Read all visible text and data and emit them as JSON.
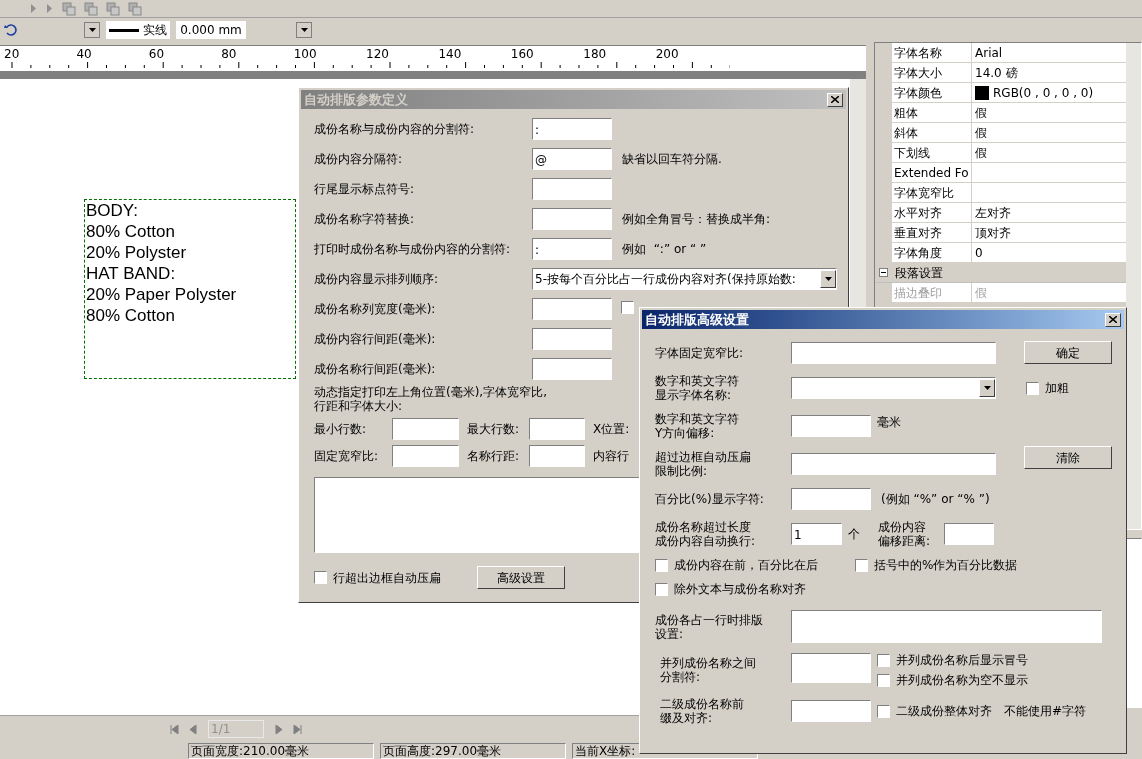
{
  "toolbar": {
    "line_style": "实线",
    "line_width": "0.000 mm"
  },
  "ruler": {
    "labels": [
      "20",
      "40",
      "60",
      "80",
      "100",
      "120",
      "140",
      "160",
      "180",
      "200"
    ]
  },
  "canvas": {
    "text_lines": [
      "BODY:",
      "80% Cotton",
      "20% Polyster",
      "HAT BAND:",
      "20% Paper Polyster",
      "80% Cotton"
    ]
  },
  "properties": {
    "rows": [
      {
        "name": "字体名称",
        "value": "Arial",
        "kind": "text",
        "disabled": false
      },
      {
        "name": "字体大小",
        "value": "14.0 磅",
        "kind": "text",
        "disabled": false
      },
      {
        "name": "字体颜色",
        "value": "RGB(0 , 0 , 0 , 0)",
        "kind": "color",
        "color": "#000000",
        "disabled": false
      },
      {
        "name": "粗体",
        "value": "假",
        "kind": "text",
        "disabled": false
      },
      {
        "name": "斜体",
        "value": "假",
        "kind": "text",
        "disabled": false
      },
      {
        "name": "下划线",
        "value": "假",
        "kind": "text",
        "disabled": false
      },
      {
        "name": "Extended Fo",
        "kind": "text",
        "disabled": false
      },
      {
        "name": "字体宽窄比",
        "kind": "text",
        "disabled": false
      },
      {
        "name": "水平对齐",
        "value": "左对齐",
        "kind": "text",
        "disabled": false
      },
      {
        "name": "垂直对齐",
        "value": "顶对齐",
        "kind": "text",
        "disabled": false
      },
      {
        "name": "字体角度",
        "value": "0",
        "kind": "text",
        "disabled": false
      },
      {
        "name": "段落设置",
        "kind": "section",
        "expanded": true
      },
      {
        "name": "描边叠印",
        "value": "假",
        "kind": "text",
        "disabled": true
      }
    ]
  },
  "page_nav": {
    "page": "1/1"
  },
  "status_bar": [
    "页面宽度:210.00毫米",
    "页面高度:297.00毫米",
    "当前X坐标:"
  ],
  "dialog_main": {
    "title": "自动排版参数定义",
    "active": false,
    "rows": [
      {
        "kind": "input",
        "label": "成份名称与成份内容的分割符:",
        "value": ":"
      },
      {
        "kind": "input",
        "label": "成份内容分隔符:",
        "value": "@",
        "note": "缺省以回车符分隔."
      },
      {
        "kind": "input",
        "label": "行尾显示标点符号:"
      },
      {
        "kind": "input",
        "label": "成份名称字符替换:",
        "note": "例如全角冒号：替换成半角:"
      },
      {
        "kind": "input",
        "label": "打印时成份名称与成份内容的分割符:",
        "value": ":",
        "note": "例如  “:” or “ ”"
      },
      {
        "kind": "select",
        "label": "成份内容显示排列顺序:",
        "value": "5-按每个百分比占一行成份内容对齐(保持原始数:"
      },
      {
        "kind": "input_check",
        "label": "成份名称列宽度(毫米):",
        "checked": false
      },
      {
        "kind": "input",
        "label": "成份内容行间距(毫米):"
      },
      {
        "kind": "input",
        "label": "成份名称行间距(毫米):"
      }
    ],
    "position_note": "动态指定打印左上角位置(毫米),字体宽窄比,\n行距和字体大小:",
    "grid": [
      [
        {
          "label": "最小行数:"
        },
        {
          "label": "最大行数:"
        },
        {
          "label": "X位置:"
        }
      ],
      [
        {
          "label": "固定宽窄比:"
        },
        {
          "label": "名称行距:"
        },
        {
          "label": "内容行"
        }
      ]
    ],
    "compress": {
      "label": "行超出边框自动压扁",
      "checked": false
    },
    "advanced_button": "高级设置"
  },
  "dialog_adv": {
    "title": "自动排版高级设置",
    "active": true,
    "width_ratio": {
      "label": "字体固定宽窄比:"
    },
    "ok_button": "确定",
    "font_name": {
      "label": "数字和英文字符显示字体名称:"
    },
    "bold": {
      "label": "加粗",
      "checked": false
    },
    "y_offset": {
      "label": "数字和英文字符\nY方向偏移:",
      "unit": "毫米"
    },
    "compress_ratio": {
      "label": "超过边框自动压扁限制比例:"
    },
    "clear_button": "清除",
    "percent_char": {
      "label": "百分比(%)显示字符:",
      "note": "(例如 “%” or “% ”)"
    },
    "wrap": {
      "label": "成份名称超过长度成份内容自动换行:",
      "value": "1",
      "unit": "个",
      "offset_label": "成份内容偏移距离:"
    },
    "checks_a": [
      {
        "label": "成份内容在前，百分比在后",
        "checked": false
      },
      {
        "label": "括号中的%作为百分比数据",
        "checked": false
      }
    ],
    "checks_b": [
      {
        "label": "除外文本与成份名称对齐",
        "checked": false
      }
    ],
    "line_layout": {
      "label": "成份各占一行时排版设置:"
    },
    "separator": {
      "label": "并列成份名称之间分割符:",
      "checks": [
        {
          "label": "并列成份名称后显示冒号",
          "checked": false
        },
        {
          "label": "并列成份名称为空不显示",
          "checked": false
        }
      ]
    },
    "prefix": {
      "label": "二级成份名称前缀及对齐:",
      "check": {
        "label": "二级成份整体对齐",
        "checked": false
      },
      "note": "不能使用#字符"
    }
  }
}
